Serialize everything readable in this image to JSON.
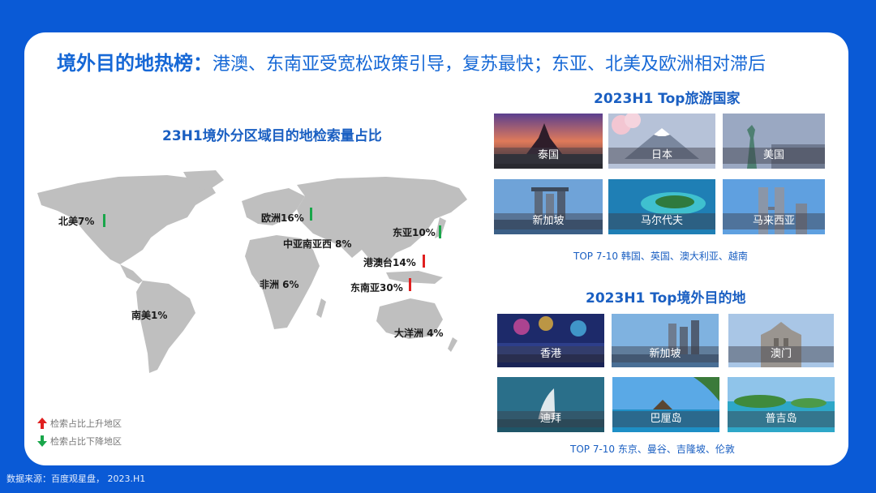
{
  "headline": {
    "strong": "境外目的地热榜：",
    "rest": "港澳、东南亚受宽松政策引导，复苏最快；东亚、北美及欧洲相对滞后"
  },
  "map": {
    "title": "23H1境外分区域目的地检索量占比",
    "regions": [
      {
        "label": "北美7%",
        "trend": "down"
      },
      {
        "label": "欧洲16%",
        "trend": "down"
      },
      {
        "label": "东亚10%",
        "trend": "down"
      },
      {
        "label": "中亚南亚西 8%",
        "trend": "none"
      },
      {
        "label": "港澳台14%",
        "trend": "up"
      },
      {
        "label": "非洲 6%",
        "trend": "none"
      },
      {
        "label": "东南亚30%",
        "trend": "up"
      },
      {
        "label": "南美1%",
        "trend": "none"
      },
      {
        "label": "大洋洲 4%",
        "trend": "none"
      }
    ],
    "legend": {
      "up": "检索占比上升地区",
      "down": "检索占比下降地区"
    },
    "colors": {
      "up": "#e02020",
      "down": "#19a64a",
      "land": "#bfbfbf"
    }
  },
  "countries": {
    "title": "2023H1  Top旅游国家",
    "tiles": [
      "泰国",
      "日本",
      "美国",
      "新加坡",
      "马尔代夫",
      "马来西亚"
    ],
    "note": "TOP 7-10  韩国、英国、澳大利亚、越南"
  },
  "destinations": {
    "title": "2023H1  Top境外目的地",
    "tiles": [
      "香港",
      "新加坡",
      "澳门",
      "迪拜",
      "巴厘岛",
      "普吉岛"
    ],
    "note": "TOP 7-10  东京、曼谷、吉隆坡、伦敦"
  },
  "source": "数据来源：百度观星盘，  2023.H1"
}
